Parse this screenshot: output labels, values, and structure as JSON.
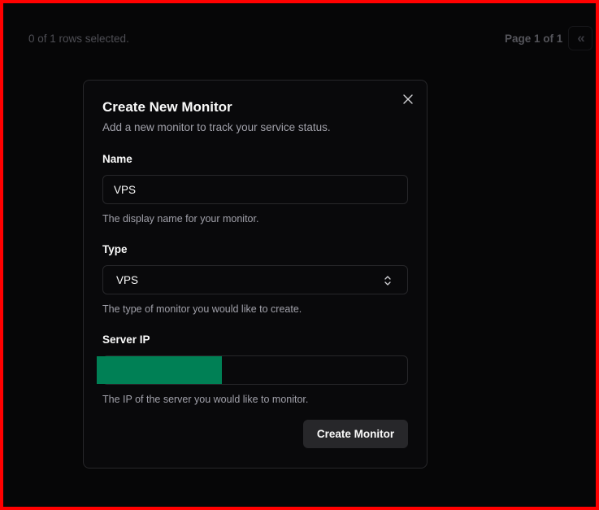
{
  "table_footer": {
    "rows_selected": "0 of 1 rows selected.",
    "page_info": "Page 1 of 1",
    "first_page_icon": "chevrons-left-icon"
  },
  "dialog": {
    "title": "Create New Monitor",
    "description": "Add a new monitor to track your service status.",
    "close_icon": "close-icon",
    "fields": {
      "name": {
        "label": "Name",
        "value": "VPS",
        "help": "The display name for your monitor."
      },
      "type": {
        "label": "Type",
        "value": "VPS",
        "icon": "chevron-up-down-icon",
        "help": "The type of monitor you would like to create."
      },
      "server_ip": {
        "label": "Server IP",
        "value": "",
        "redacted": true,
        "redaction_color": "#008055",
        "help": "The IP of the server you would like to monitor."
      }
    },
    "submit_label": "Create Monitor"
  },
  "colors": {
    "frame_border": "#ff0000",
    "background": "#060607",
    "dialog_bg": "#09090b",
    "border": "#27272a",
    "muted_text": "#a1a1aa",
    "button_bg": "#27272a"
  }
}
